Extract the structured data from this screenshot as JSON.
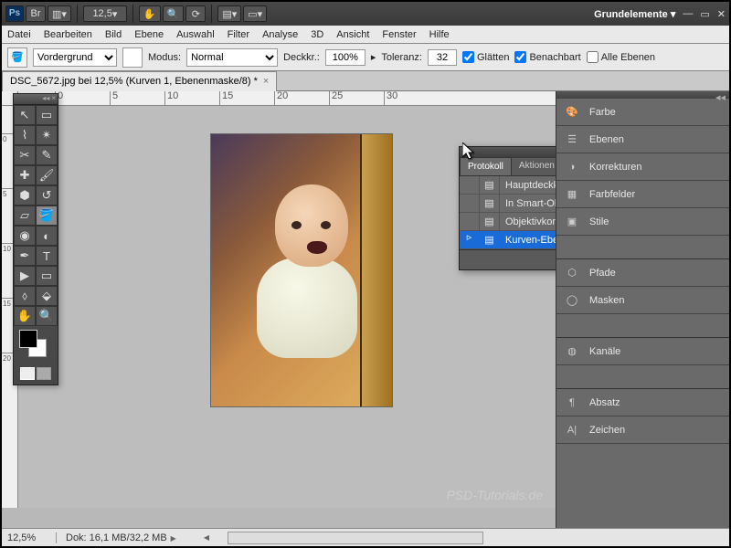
{
  "titlebar": {
    "zoom": "12,5",
    "workspace": "Grundelemente"
  },
  "menu": [
    "Datei",
    "Bearbeiten",
    "Bild",
    "Ebene",
    "Auswahl",
    "Filter",
    "Analyse",
    "3D",
    "Ansicht",
    "Fenster",
    "Hilfe"
  ],
  "options": {
    "fill_mode": "Vordergrund",
    "mode_label": "Modus:",
    "blend_mode": "Normal",
    "opacity_label": "Deckkr.:",
    "opacity_value": "100%",
    "tolerance_label": "Toleranz:",
    "tolerance_value": "32",
    "antialias": "Glätten",
    "contiguous": "Benachbart",
    "all_layers": "Alle Ebenen"
  },
  "document": {
    "tab": "DSC_5672.jpg bei 12,5% (Kurven 1, Ebenenmaske/8) *"
  },
  "ruler_h": [
    "0",
    "5",
    "10",
    "15",
    "20",
    "25",
    "30"
  ],
  "ruler_v": [
    "0",
    "5",
    "10",
    "15",
    "20"
  ],
  "history": {
    "tab1": "Protokoll",
    "tab2": "Aktionen",
    "items": [
      "Hauptdeckkraft ändern",
      "In Smart-Objekt konvertie...",
      "Objektivkorrektur",
      "Kurven-Ebene verändern"
    ]
  },
  "dock": {
    "farbe": "Farbe",
    "ebenen": "Ebenen",
    "korrekturen": "Korrekturen",
    "farbfelder": "Farbfelder",
    "stile": "Stile",
    "pfade": "Pfade",
    "masken": "Masken",
    "kanaele": "Kanäle",
    "absatz": "Absatz",
    "zeichen": "Zeichen"
  },
  "status": {
    "zoom": "12,5%",
    "docinfo": "Dok: 16,1 MB/32,2 MB"
  },
  "watermark": "PSD-Tutorials.de"
}
